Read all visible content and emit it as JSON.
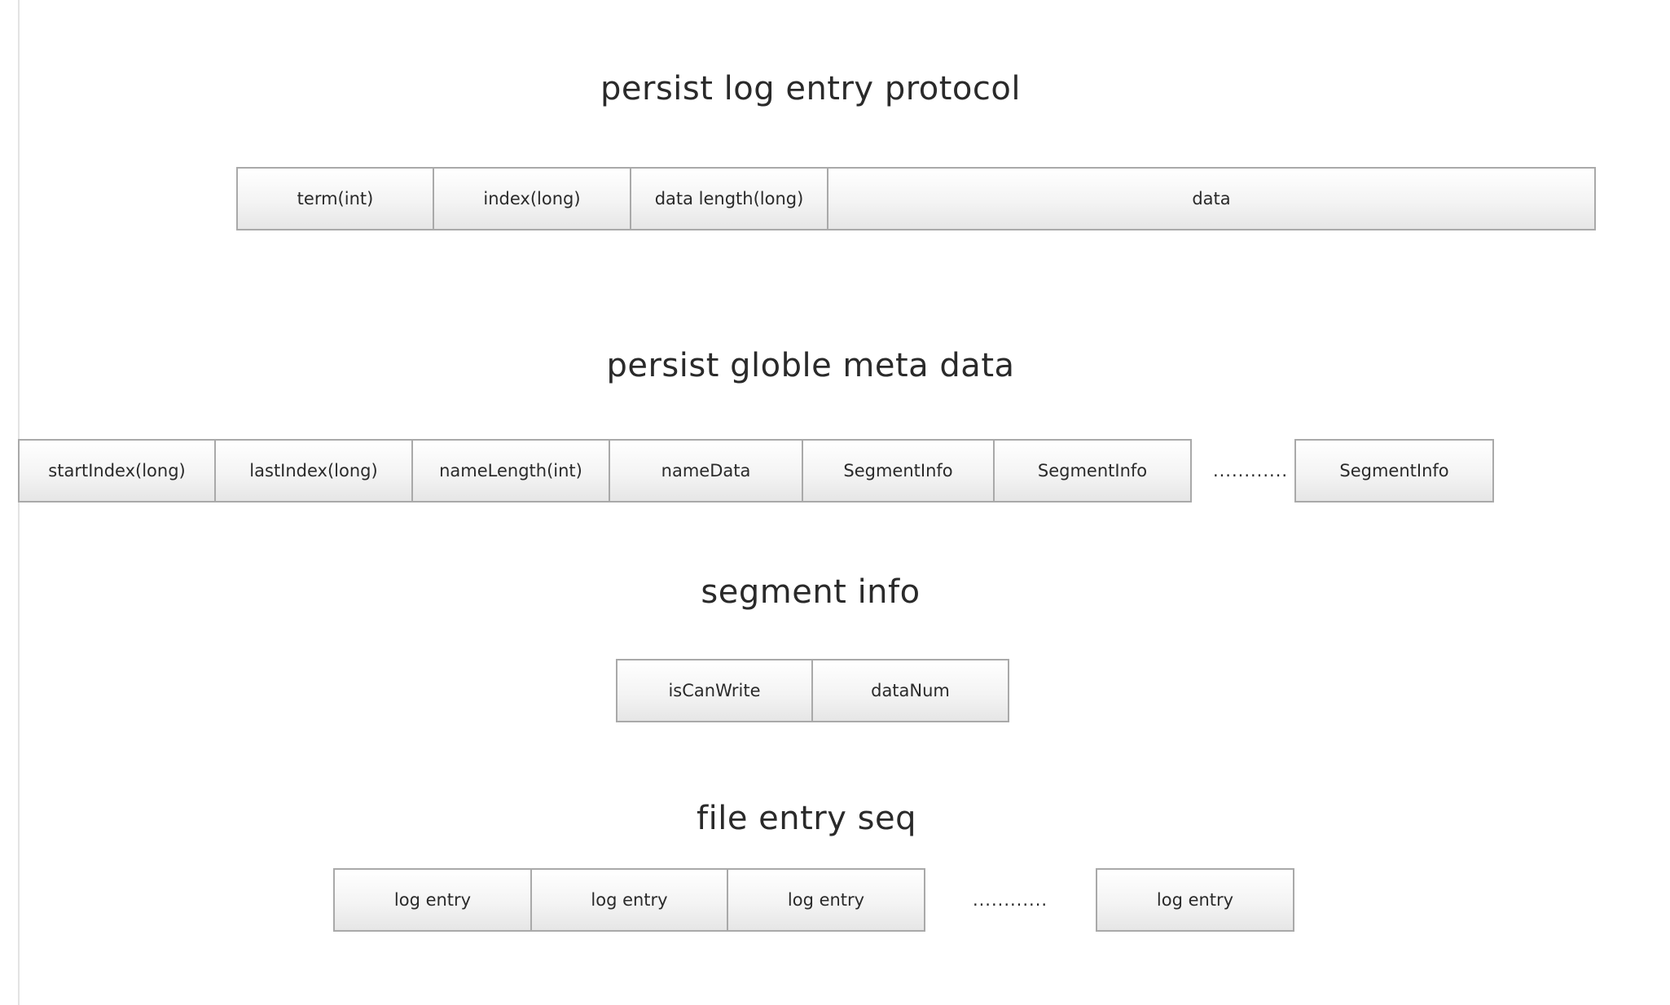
{
  "sections": {
    "log_entry_protocol": {
      "title": "persist log entry protocol",
      "fields": [
        "term(int)",
        "index(long)",
        "data length(long)",
        "data"
      ]
    },
    "globle_meta_data": {
      "title": "persist globle meta data",
      "fields": [
        "startIndex(long)",
        "lastIndex(long)",
        "nameLength(int)",
        "nameData",
        "SegmentInfo",
        "SegmentInfo"
      ],
      "ellipsis": "............",
      "tail_field": "SegmentInfo"
    },
    "segment_info": {
      "title": "segment info",
      "fields": [
        "isCanWrite",
        "dataNum"
      ]
    },
    "file_entry_seq": {
      "title": "file entry seq",
      "fields": [
        "log entry",
        "log entry",
        "log entry"
      ],
      "ellipsis": "............",
      "tail_field": "log entry"
    }
  }
}
